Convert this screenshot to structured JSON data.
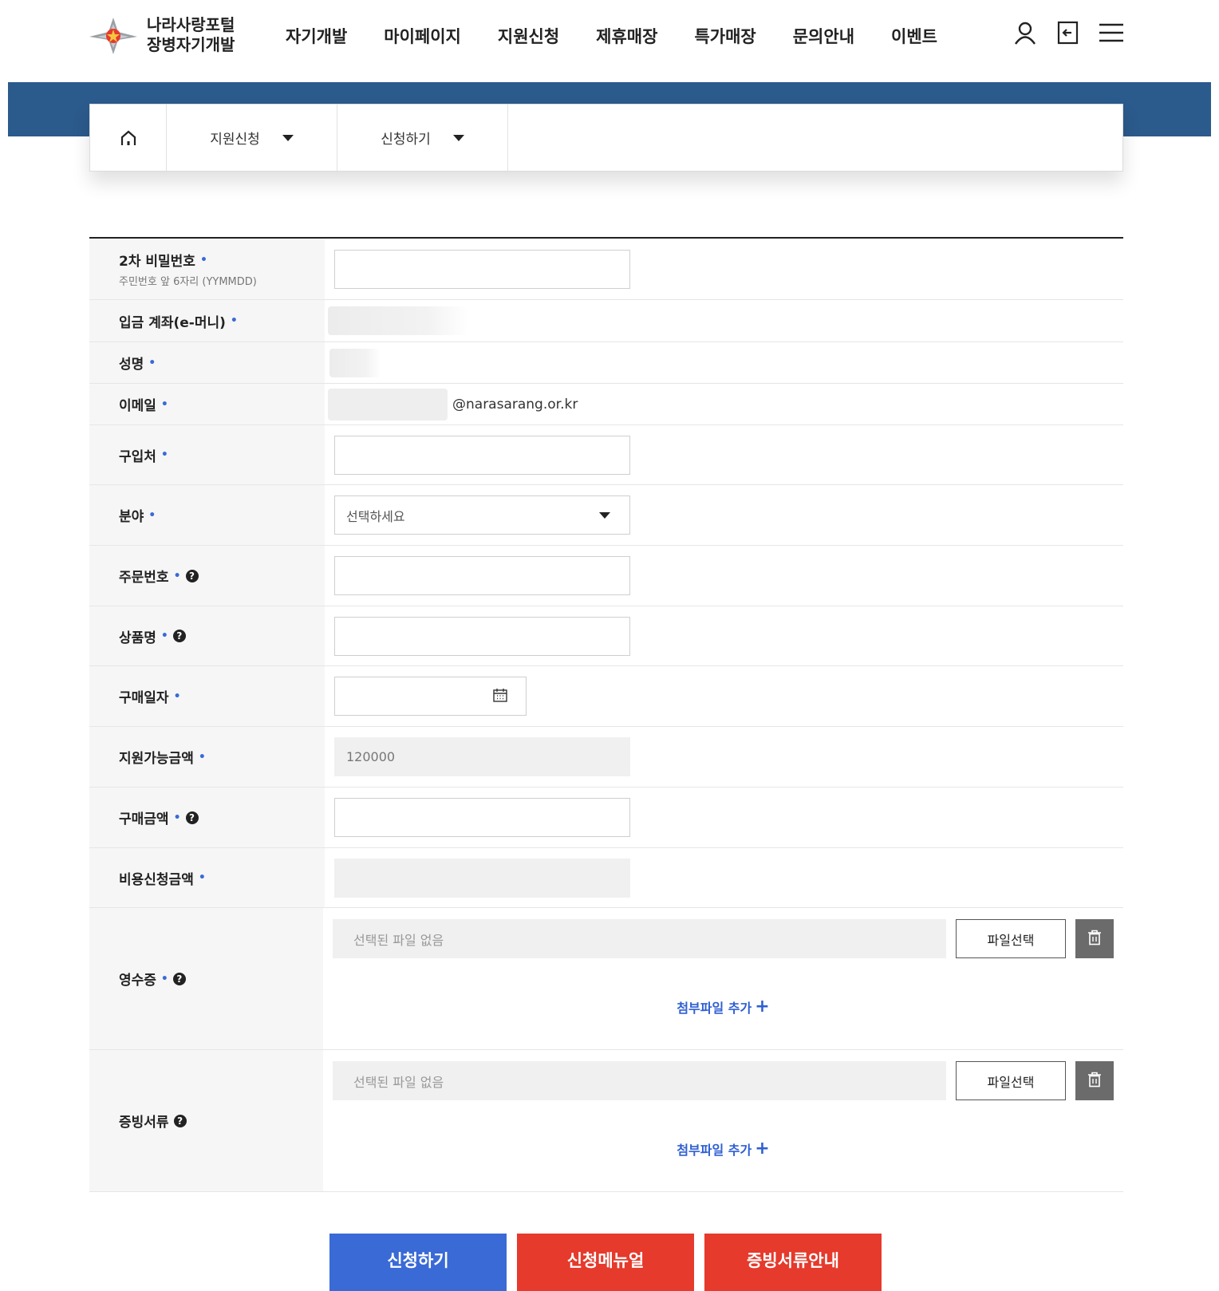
{
  "brand": {
    "line1": "나라사랑포털",
    "line2": "장병자기개발"
  },
  "nav": [
    "자기개발",
    "마이페이지",
    "지원신청",
    "제휴매장",
    "특가매장",
    "문의안내",
    "이벤트"
  ],
  "header_icons": [
    "user-icon",
    "logout-icon",
    "menu-icon"
  ],
  "breadcrumb": {
    "home_icon": "home-icon",
    "level1": "지원신청",
    "level2": "신청하기"
  },
  "required_mark": "•",
  "help_mark": "?",
  "form": {
    "password": {
      "label": "2차 비밀번호",
      "sub": "주민번호 앞 6자리 (YYMMDD)",
      "value": ""
    },
    "account": {
      "label": "입금 계좌(e-머니)"
    },
    "name": {
      "label": "성명"
    },
    "email": {
      "label": "이메일",
      "domain": "@narasarang.or.kr"
    },
    "store": {
      "label": "구입처",
      "value": ""
    },
    "category": {
      "label": "분야",
      "selected": "선택하세요"
    },
    "order_no": {
      "label": "주문번호",
      "value": ""
    },
    "product": {
      "label": "상품명",
      "value": ""
    },
    "purchase_date": {
      "label": "구매일자",
      "value": ""
    },
    "available_amount": {
      "label": "지원가능금액",
      "value": "120000"
    },
    "purchase_amount": {
      "label": "구매금액",
      "value": ""
    },
    "claim_amount": {
      "label": "비용신청금액",
      "value": ""
    },
    "receipt": {
      "label": "영수증",
      "file_placeholder": "선택된 파일 없음",
      "file_button": "파일선택",
      "add_file": "첨부파일 추가"
    },
    "evidence": {
      "label": "증빙서류",
      "file_placeholder": "선택된 파일 없음",
      "file_button": "파일선택",
      "add_file": "첨부파일 추가"
    }
  },
  "actions": {
    "apply": "신청하기",
    "manual": "신청메뉴얼",
    "guide": "증빙서류안내"
  },
  "colors": {
    "banner": "#2b5a8c",
    "primary": "#3a6ad6",
    "danger": "#e53a2c",
    "link": "#2f5fd2"
  }
}
